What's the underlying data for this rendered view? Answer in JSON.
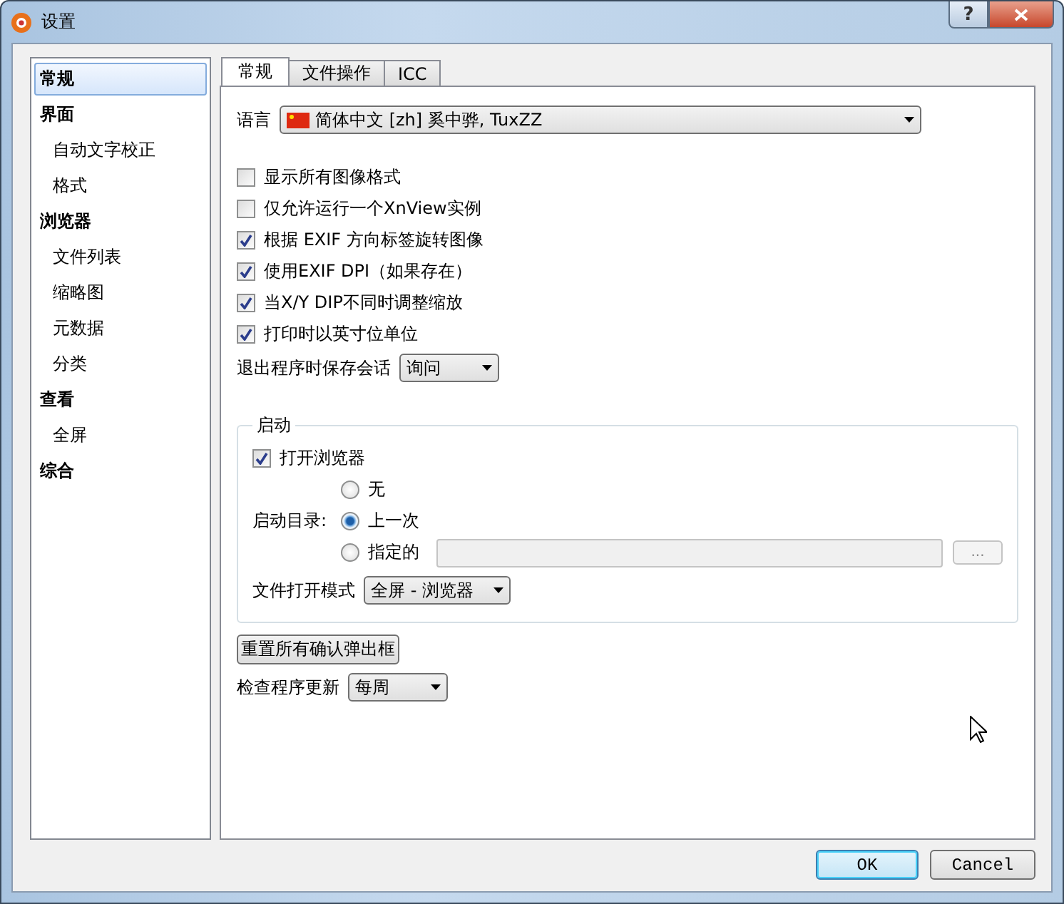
{
  "window": {
    "title": "设置",
    "help": "?"
  },
  "sidebar": {
    "items": [
      {
        "label": "常规",
        "selected": true
      },
      {
        "label": "界面",
        "selected": false,
        "children": [
          {
            "label": "自动文字校正",
            "selected": false
          },
          {
            "label": "格式",
            "selected": false
          }
        ]
      },
      {
        "label": "浏览器",
        "selected": false,
        "children": [
          {
            "label": "文件列表",
            "selected": false
          },
          {
            "label": "缩略图",
            "selected": false
          },
          {
            "label": "元数据",
            "selected": false
          },
          {
            "label": "分类",
            "selected": false
          }
        ]
      },
      {
        "label": "查看",
        "selected": false,
        "children": [
          {
            "label": "全屏",
            "selected": false
          }
        ]
      },
      {
        "label": "综合",
        "selected": false
      }
    ]
  },
  "tabs": [
    {
      "label": "常规",
      "selected": true
    },
    {
      "label": "文件操作",
      "selected": false
    },
    {
      "label": "ICC",
      "selected": false
    }
  ],
  "language": {
    "label": "语言",
    "value": "简体中文 [zh] 奚中骅, TuxZZ"
  },
  "options": [
    {
      "label": "显示所有图像格式",
      "checked": false
    },
    {
      "label": "仅允许运行一个XnView实例",
      "checked": false
    },
    {
      "label": "根据 EXIF 方向标签旋转图像",
      "checked": true
    },
    {
      "label": "使用EXIF DPI（如果存在）",
      "checked": true
    },
    {
      "label": "当X/Y DIP不同时调整缩放",
      "checked": true
    },
    {
      "label": "打印时以英寸位单位",
      "checked": true
    }
  ],
  "save_session": {
    "label": "退出程序时保存会话",
    "value": "询问"
  },
  "startup": {
    "title": "启动",
    "open_browser": {
      "label": "打开浏览器",
      "checked": true
    },
    "folder_label": "启动目录:",
    "radios": [
      {
        "label": "无",
        "selected": false
      },
      {
        "label": "上一次",
        "selected": true
      },
      {
        "label": "指定的",
        "selected": false
      }
    ],
    "browse": "...",
    "mode": {
      "label": "文件打开模式",
      "value": "全屏 - 浏览器"
    }
  },
  "reset_button": "重置所有确认弹出框",
  "update": {
    "label": "检查程序更新",
    "value": "每周"
  },
  "buttons": [
    {
      "label": "OK",
      "default": true
    },
    {
      "label": "Cancel",
      "default": false
    }
  ]
}
